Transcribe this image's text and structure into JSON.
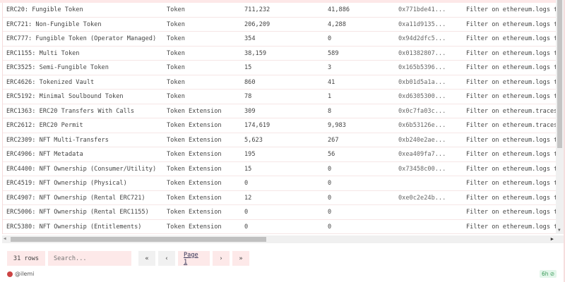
{
  "table": {
    "rows": [
      [
        "ERC20: Fungible Token",
        "Token",
        "711,232",
        "41,886",
        "0x771bde41...",
        "Filter on ethereum.logs t"
      ],
      [
        "ERC721: Non-Fungible Token",
        "Token",
        "206,209",
        "4,288",
        "0xa11d9135...",
        "Filter on ethereum.logs t"
      ],
      [
        "ERC777: Fungible Token (Operator Managed)",
        "Token",
        "354",
        "0",
        "0x94d2dfc5...",
        "Filter on ethereum.logs t"
      ],
      [
        "ERC1155: Multi Token",
        "Token",
        "38,159",
        "589",
        "0x01382807...",
        "Filter on ethereum.logs t"
      ],
      [
        "ERC3525: Semi-Fungible Token",
        "Token",
        "15",
        "3",
        "0x165b5396...",
        "Filter on ethereum.logs t"
      ],
      [
        "ERC4626: Tokenized Vault",
        "Token",
        "860",
        "41",
        "0xb01d5a1a...",
        "Filter on ethereum.logs t"
      ],
      [
        "ERC5192: Minimal Soulbound Token",
        "Token",
        "78",
        "1",
        "0xd6305300...",
        "Filter on ethereum.logs t"
      ],
      [
        "ERC1363: ERC20 Transfers With Calls",
        "Token Extension",
        "309",
        "8",
        "0x0c7fa03c...",
        "Filter on ethereum.traces"
      ],
      [
        "ERC2612: ERC20 Permit",
        "Token Extension",
        "174,619",
        "9,983",
        "0x6b53126e...",
        "Filter on ethereum.traces"
      ],
      [
        "ERC2309: NFT Multi-Transfers",
        "Token Extension",
        "5,623",
        "267",
        "0xb240e2ae...",
        "Filter on ethereum.logs t"
      ],
      [
        "ERC4906: NFT Metadata",
        "Token Extension",
        "195",
        "56",
        "0xea409fa7...",
        "Filter on ethereum.logs t"
      ],
      [
        "ERC4400: NFT Ownership (Consumer/Utility)",
        "Token Extension",
        "15",
        "0",
        "0x73458c00...",
        "Filter on ethereum.logs t"
      ],
      [
        "ERC4519: NFT Ownership (Physical)",
        "Token Extension",
        "0",
        "0",
        "",
        "Filter on ethereum.logs t"
      ],
      [
        "ERC4907: NFT Ownership (Rental ERC721)",
        "Token Extension",
        "12",
        "0",
        "0xe0c2e24b...",
        "Filter on ethereum.logs t"
      ],
      [
        "ERC5006: NFT Ownership (Rental ERC1155)",
        "Token Extension",
        "0",
        "0",
        "",
        "Filter on ethereum.logs t"
      ],
      [
        "ERC5380: NFT Ownership (Entitlements)",
        "Token Extension",
        "0",
        "0",
        "",
        "Filter on ethereum.logs t"
      ]
    ]
  },
  "footer": {
    "rows_label": "31 rows",
    "search_placeholder": "Search...",
    "first": "«",
    "prev": "‹",
    "page": "Page 1",
    "next": "›",
    "last": "»"
  },
  "user": {
    "name": "@ilemi"
  },
  "badge": {
    "text": "6h"
  },
  "colors": {
    "accent": "#fde9e9"
  }
}
